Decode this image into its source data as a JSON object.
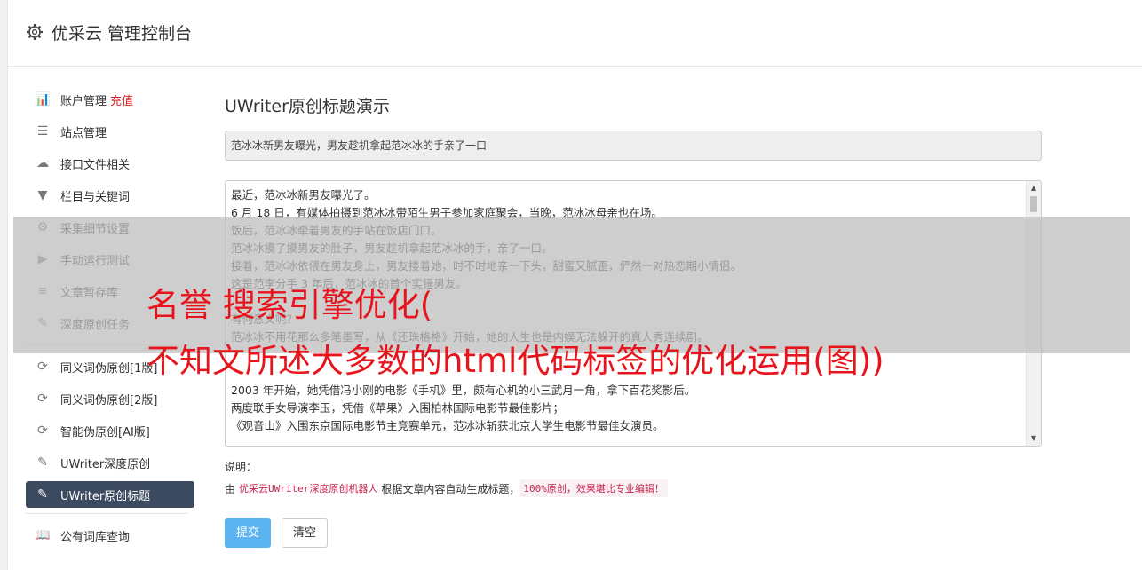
{
  "header": {
    "title": "优采云 管理控制台",
    "icon": "gear-icon"
  },
  "sidebar": {
    "group1": [
      {
        "label": "账户管理",
        "badge": "充值",
        "icon": "bar-chart-icon",
        "glyph": "📊"
      },
      {
        "label": "站点管理",
        "icon": "server-icon",
        "glyph": "☰"
      },
      {
        "label": "接口文件相关",
        "icon": "cloud-upload-icon",
        "glyph": "☁"
      },
      {
        "label": "栏目与关键词",
        "icon": "filter-icon",
        "glyph": "▼"
      },
      {
        "label": "采集细节设置",
        "icon": "cogs-icon",
        "glyph": "⚙"
      },
      {
        "label": "手动运行测试",
        "icon": "play-circle-icon",
        "glyph": "▶"
      },
      {
        "label": "文章暂存库",
        "icon": "database-icon",
        "glyph": "≡"
      },
      {
        "label": "深度原创任务",
        "icon": "edit-icon",
        "glyph": "✎"
      }
    ],
    "group2": [
      {
        "label": "同义词伪原创[1版]",
        "icon": "refresh-icon",
        "glyph": "⟳"
      },
      {
        "label": "同义词伪原创[2版]",
        "icon": "refresh-icon",
        "glyph": "⟳"
      },
      {
        "label": "智能伪原创[AI版]",
        "icon": "refresh-icon",
        "glyph": "⟳"
      },
      {
        "label": "UWriter深度原创",
        "icon": "edit-icon",
        "glyph": "✎"
      },
      {
        "label": "UWriter原创标题",
        "icon": "edit-icon",
        "glyph": "✎",
        "active": true
      }
    ],
    "group3": [
      {
        "label": "公有词库查询",
        "icon": "book-icon",
        "glyph": "📖"
      }
    ]
  },
  "main": {
    "title": "UWriter原创标题演示",
    "title_value": "范冰冰新男友曝光，男友趁机拿起范冰冰的手亲了一口",
    "content_lines": [
      "最近，范冰冰新男友曝光了。",
      "6 月 18 日，有媒体拍摄到范冰冰带陌生男子参加家庭聚会，当晚，范冰冰母亲也在场。",
      "饭后，范冰冰牵着男友的手站在饭店门口。",
      "范冰冰摸了摸男友的肚子，男友趁机拿起范冰冰的手，亲了一口。",
      "接着，范冰冰依偎在男友身上，男友搂着她，时不时地亲一下头，甜蜜又腻歪，俨然一对热恋期小情侣。",
      "这是范李分手 3 年后，范冰冰的首个实锤男友。",
      "",
      "有何意义呢？",
      "范冰冰不用花那么多笔墨写，从《还珠格格》开始，她的人生也是内娱无法躲开的真人秀连续剧。",
      "",
      "",
      "2003 年开始，她凭借冯小刚的电影《手机》里，颇有心机的小三武月一角，拿下百花奖影后。",
      "两度联手女导演李玉，凭借《苹果》入围柏林国际电影节最佳影片；",
      "《观音山》入围东京国际电影节主竞赛单元，范冰冰斩获北京大学生电影节最佳女演员。"
    ],
    "note_label": "说明：",
    "note_prefix": "由",
    "note_code1": "优采云UWriter深度原创机器人",
    "note_middle": "根据文章内容自动生成标题，",
    "note_code2": "100%原创，效果堪比专业编辑！",
    "submit_label": "提交",
    "clear_label": "清空"
  },
  "overlay": {
    "line1": "名誉 搜索引擎优化(",
    "line2": "不知文所述大多数的html代码标签的优化运用(图))"
  }
}
